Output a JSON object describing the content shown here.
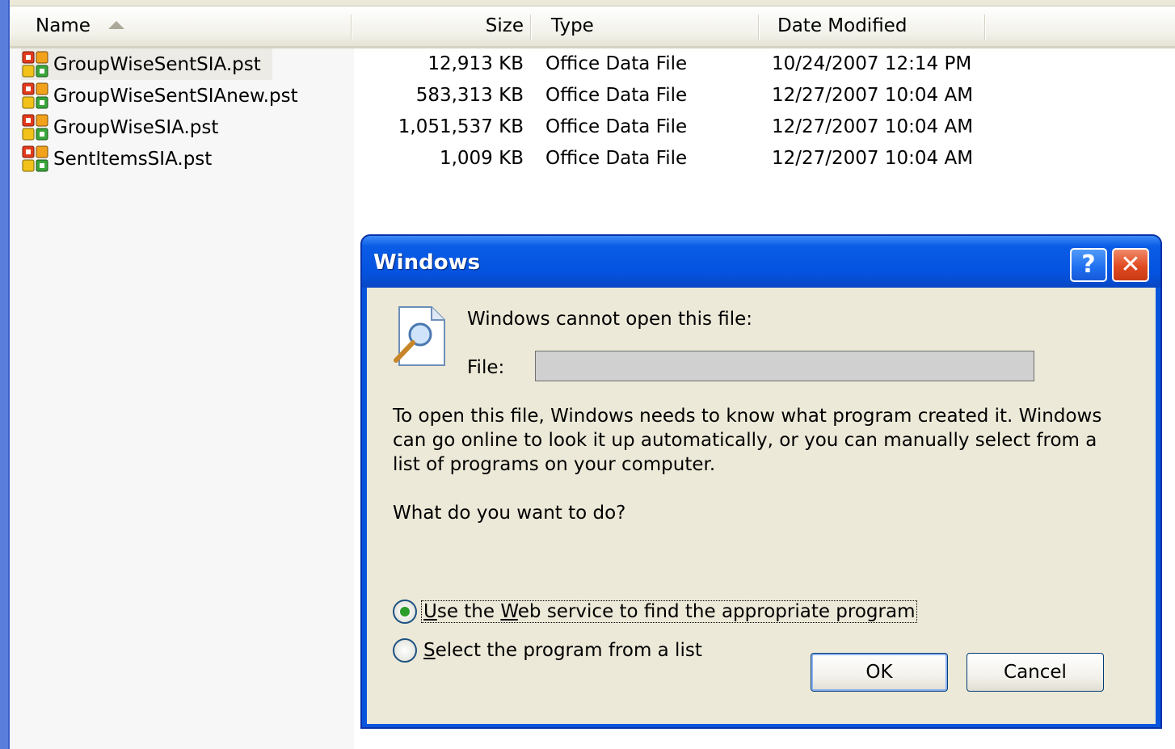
{
  "explorer": {
    "columns": {
      "name": "Name",
      "size": "Size",
      "type": "Type",
      "date": "Date Modified"
    },
    "files": [
      {
        "name": "GroupWiseSentSIA.pst",
        "size": "12,913 KB",
        "type": "Office Data File",
        "date": "10/24/2007 12:14 PM"
      },
      {
        "name": "GroupWiseSentSIAnew.pst",
        "size": "583,313 KB",
        "type": "Office Data File",
        "date": "12/27/2007 10:04 AM"
      },
      {
        "name": "GroupWiseSIA.pst",
        "size": "1,051,537 KB",
        "type": "Office Data File",
        "date": "12/27/2007 10:04 AM"
      },
      {
        "name": "SentItemsSIA.pst",
        "size": "1,009 KB",
        "type": "Office Data File",
        "date": "12/27/2007 10:04 AM"
      }
    ],
    "selected_index": 0,
    "icon": "outlook-pst-icon"
  },
  "dialog": {
    "title": "Windows",
    "help_button": "?",
    "close_button": "✕",
    "message": "Windows cannot open this file:",
    "file_label": "File:",
    "file_value": "",
    "paragraph": "To open this file, Windows needs to know what program created it.  Windows can go online to look it up automatically, or you can manually select from a list of programs on your computer.",
    "question": "What do you want to do?",
    "options": [
      {
        "pre": "",
        "accel": "U",
        "mid": "se the ",
        "accel2": "W",
        "post": "eb service to find the appropriate program",
        "selected": true
      },
      {
        "pre": "",
        "accel": "S",
        "post": "elect the program from a list",
        "selected": false
      }
    ],
    "ok_label": "OK",
    "cancel_label": "Cancel",
    "icon": "document-magnifier-icon"
  },
  "colors": {
    "titlebar": "#0453e0",
    "dialog_bg": "#ece9d8",
    "radio_dot": "#2a9d2a"
  }
}
